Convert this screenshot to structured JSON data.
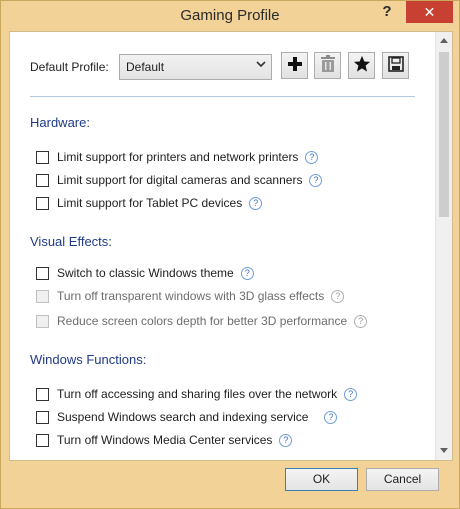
{
  "window": {
    "title": "Gaming Profile",
    "help_label": "?",
    "close_label": "✕"
  },
  "profile": {
    "label": "Default Profile:",
    "selected": "Default"
  },
  "sections": {
    "hardware": {
      "title": "Hardware:",
      "options": [
        {
          "label": "Limit support for printers and network printers",
          "checked": false,
          "enabled": true
        },
        {
          "label": "Limit support for digital cameras and scanners",
          "checked": false,
          "enabled": true
        },
        {
          "label": "Limit support for Tablet PC devices",
          "checked": false,
          "enabled": true
        }
      ]
    },
    "visual": {
      "title": "Visual Effects:",
      "options": [
        {
          "label": "Switch to classic Windows theme",
          "checked": false,
          "enabled": true
        },
        {
          "label": "Turn off transparent windows with 3D glass effects",
          "checked": false,
          "enabled": false
        },
        {
          "label": "Reduce screen colors depth for better 3D performance",
          "checked": false,
          "enabled": false
        }
      ]
    },
    "windows": {
      "title": "Windows Functions:",
      "options": [
        {
          "label": "Turn off accessing and sharing files over the network",
          "checked": false,
          "enabled": true
        },
        {
          "label": "Suspend Windows search and indexing service",
          "checked": false,
          "enabled": true
        },
        {
          "label": "Turn off Windows Media Center services",
          "checked": false,
          "enabled": true
        }
      ]
    }
  },
  "buttons": {
    "ok": "OK",
    "cancel": "Cancel"
  },
  "help_glyph": "?",
  "colors": {
    "title_bar": "#f2d296",
    "close": "#c84031",
    "section_title": "#1f3a8a"
  }
}
